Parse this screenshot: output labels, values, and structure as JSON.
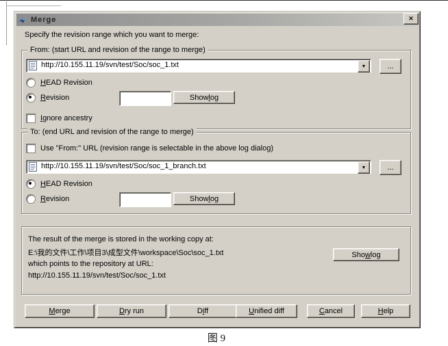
{
  "figure": {
    "caption": "图 9"
  },
  "window": {
    "title": "Merge"
  },
  "icons": {
    "close": "✕",
    "dropdown": "▼"
  },
  "intro_text": "Specify the revision range which you want to merge:",
  "from_group": {
    "legend": "From: (start URL and revision of the range to merge)",
    "url": "http://10.155.11.19/svn/test/Soc/soc_1.txt",
    "browse_label": "...",
    "head_revision": {
      "text": "HEAD Revision",
      "u": 0,
      "selected": false
    },
    "revision": {
      "text": "Revision",
      "u": 0,
      "selected": true
    },
    "revision_value": "",
    "show_log": {
      "text": "Show log",
      "u": 5
    },
    "ignore_ancestry": {
      "text": "Ignore ancestry",
      "u": 0,
      "checked": false
    }
  },
  "to_group": {
    "legend": "To: (end URL and revision of the range to merge)",
    "use_from_url": {
      "text": "Use \"From:\" URL (revision range is selectable in the above log dialog)",
      "checked": false
    },
    "url": "http://10.155.11.19/svn/test/Soc/soc_1_branch.txt",
    "browse_label": "...",
    "head_revision": {
      "text": "HEAD Revision",
      "u": 0,
      "selected": true
    },
    "revision": {
      "text": "Revision",
      "u": 0,
      "selected": false
    },
    "revision_value": "",
    "show_log": {
      "text": "Show log",
      "u": 5
    }
  },
  "result_group": {
    "line1": "The result of the merge is stored in the working copy at:",
    "working_copy_path": "E:\\我的文件\\工作\\项目3\\成型文件\\workspace\\Soc\\soc_1.txt",
    "line2": "which points to the repository at URL:",
    "repository_url": "http://10.155.11.19/svn/test/Soc/soc_1.txt",
    "show_log": {
      "text": "Show log",
      "u": 3
    }
  },
  "buttons": [
    {
      "text": "Merge",
      "u": 0
    },
    {
      "text": "Dry run",
      "u": 0
    },
    {
      "text": "Diff",
      "u": 1
    },
    {
      "text": "Unified diff",
      "u": 0
    },
    {
      "text": "Cancel",
      "u": 0
    },
    {
      "text": "Help",
      "u": 0
    }
  ],
  "colors": {
    "dialog_face": "#d4d0c8",
    "titlebar_left": "#8d8d8e",
    "titlebar_right": "#c7c6c2"
  }
}
